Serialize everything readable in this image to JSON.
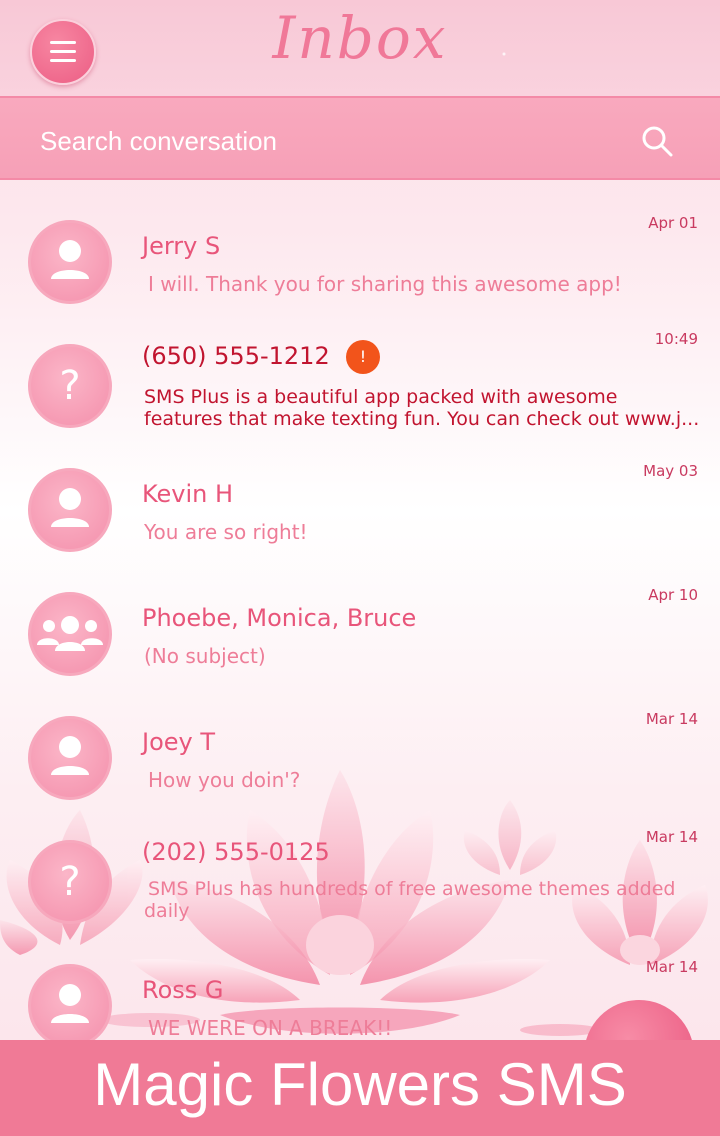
{
  "header": {
    "title": "Inbox",
    "menu_icon": "hamburger-menu-icon"
  },
  "search": {
    "placeholder": "Search conversation",
    "icon": "search-icon"
  },
  "conversations": [
    {
      "name": "Jerry S",
      "snippet": "I will. Thank you for sharing this awesome app!",
      "date": "Apr 01",
      "avatar": "person-icon",
      "unread": false
    },
    {
      "name": "(650) 555-1212",
      "snippet_line1": "SMS Plus is a beautiful app packed with awesome",
      "snippet_line2": "features that make texting fun. You can check out www.j...",
      "date": "10:49",
      "avatar": "question-mark-icon",
      "unread": true,
      "badge": "!"
    },
    {
      "name": "Kevin H",
      "snippet": "You are so right!",
      "date": "May 03",
      "avatar": "person-icon",
      "unread": false
    },
    {
      "name": "Phoebe, Monica, Bruce",
      "snippet": "(No subject)",
      "date": "Apr 10",
      "avatar": "group-icon",
      "unread": false
    },
    {
      "name": "Joey T",
      "snippet": "How you doin'?",
      "date": "Mar 14",
      "avatar": "person-icon",
      "unread": false
    },
    {
      "name": "(202) 555-0125",
      "snippet_line1": "SMS Plus has hundreds of free awesome themes added",
      "snippet_line2": "daily",
      "date": "Mar 14",
      "avatar": "question-mark-icon",
      "unread": false
    },
    {
      "name": "Ross G",
      "snippet": "WE WERE ON A BREAK!!",
      "date": "Mar 14",
      "avatar": "person-icon",
      "unread": false
    }
  ],
  "banner": {
    "text": "Magic Flowers SMS"
  },
  "colors": {
    "accent": "#f07a96",
    "unread": "#c1142f",
    "name": "#e8557a"
  }
}
